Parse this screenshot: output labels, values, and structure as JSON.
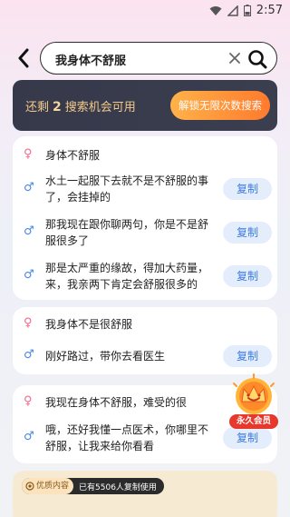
{
  "status_bar": {
    "time": "2:57",
    "icons": [
      "wifi-icon",
      "signal-icon",
      "battery-icon"
    ]
  },
  "search": {
    "query": "我身体不舒服"
  },
  "quota": {
    "prefix": "还剩",
    "count": "2",
    "suffix": "搜索机会可用",
    "unlock_label": "解锁无限次数搜索"
  },
  "conversations": [
    {
      "messages": [
        {
          "gender": "female",
          "symbol": "♀",
          "text": "身体不舒服",
          "copy": ""
        },
        {
          "gender": "male",
          "symbol": "♂",
          "text": "水土一起服下去就不是不舒服的事了，会挂掉的",
          "copy": "复制"
        },
        {
          "gender": "male",
          "symbol": "♂",
          "text": "那我现在跟你聊两句，你是不是舒服很多了",
          "copy": "复制"
        },
        {
          "gender": "male",
          "symbol": "♂",
          "text": "那是太严重的缘故，得加大药量，来，我亲两下肯定会舒服很多的",
          "copy": "复制"
        }
      ]
    },
    {
      "messages": [
        {
          "gender": "female",
          "symbol": "♀",
          "text": "我身体不是很舒服",
          "copy": ""
        },
        {
          "gender": "male",
          "symbol": "♂",
          "text": "刚好路过，带你去看医生",
          "copy": "复制"
        }
      ]
    },
    {
      "messages": [
        {
          "gender": "female",
          "symbol": "♀",
          "text": "我现在身体不舒服，难受的很",
          "copy": ""
        },
        {
          "gender": "male",
          "symbol": "♂",
          "text": "哦，还好我懂一点医术，你哪里不舒服，让我来给你看看",
          "copy": "复制"
        }
      ]
    }
  ],
  "vip_badge": {
    "label": "永久会员"
  },
  "bottom_card": {
    "tag": "优质内容",
    "usage": "已有5506人复制使用"
  },
  "colors": {
    "female": "#f06a8a",
    "male": "#4a86e8",
    "copy_text": "#3b7be3",
    "copy_bg": "#e4edfb",
    "quota_bg": "#35394a",
    "unlock_gradient_start": "#ffb24a",
    "unlock_gradient_end": "#ff7a2d"
  }
}
